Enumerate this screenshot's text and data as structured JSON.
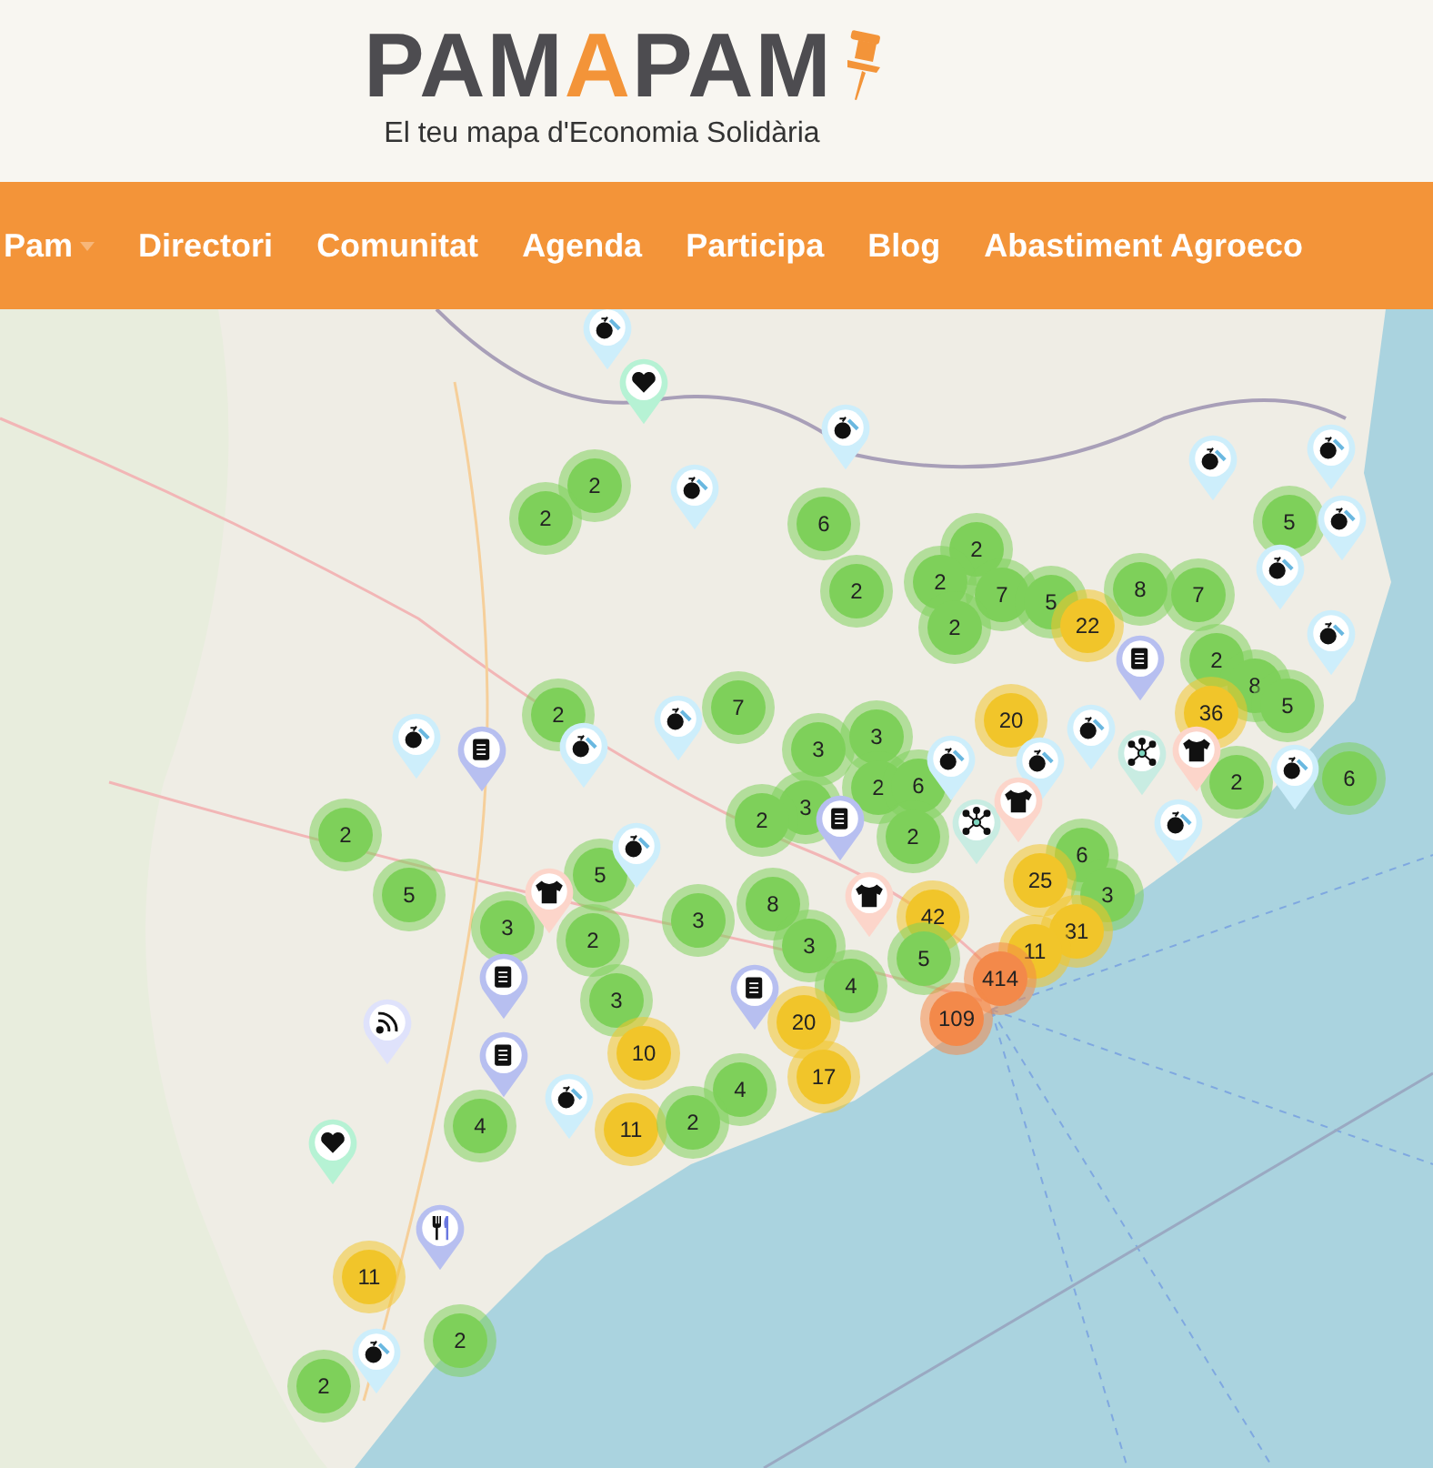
{
  "logo": {
    "parts": [
      "PAM",
      "A",
      "PAM"
    ],
    "tagline": "El teu mapa d'Economia Solidària"
  },
  "nav": [
    {
      "label": "Pam",
      "dropdown": true
    },
    {
      "label": "Directori",
      "dropdown": false
    },
    {
      "label": "Comunitat",
      "dropdown": false
    },
    {
      "label": "Agenda",
      "dropdown": false
    },
    {
      "label": "Participa",
      "dropdown": false
    },
    {
      "label": "Blog",
      "dropdown": false
    },
    {
      "label": "Abastiment Agroeco",
      "dropdown": false
    }
  ],
  "map": {
    "clusters": [
      {
        "count": "2",
        "color": "#7ed05a"
      },
      {
        "count": "2",
        "color": "#7ed05a"
      },
      {
        "count": "6",
        "color": "#7ed05a"
      },
      {
        "count": "2",
        "color": "#7ed05a"
      },
      {
        "count": "2",
        "color": "#7ed05a"
      },
      {
        "count": "2",
        "color": "#7ed05a"
      },
      {
        "count": "7",
        "color": "#7ed05a"
      },
      {
        "count": "2",
        "color": "#7ed05a"
      },
      {
        "count": "5",
        "color": "#7ed05a"
      },
      {
        "count": "22",
        "color": "#f1c52a"
      },
      {
        "count": "8",
        "color": "#7ed05a"
      },
      {
        "count": "7",
        "color": "#7ed05a"
      },
      {
        "count": "5",
        "color": "#7ed05a"
      },
      {
        "count": "2",
        "color": "#7ed05a"
      },
      {
        "count": "8",
        "color": "#7ed05a"
      },
      {
        "count": "36",
        "color": "#f1c52a"
      },
      {
        "count": "5",
        "color": "#7ed05a"
      },
      {
        "count": "2",
        "color": "#7ed05a"
      },
      {
        "count": "6",
        "color": "#7ed05a"
      },
      {
        "count": "2",
        "color": "#7ed05a"
      },
      {
        "count": "7",
        "color": "#7ed05a"
      },
      {
        "count": "20",
        "color": "#f1c52a"
      },
      {
        "count": "3",
        "color": "#7ed05a"
      },
      {
        "count": "3",
        "color": "#7ed05a"
      },
      {
        "count": "2",
        "color": "#7ed05a"
      },
      {
        "count": "6",
        "color": "#7ed05a"
      },
      {
        "count": "3",
        "color": "#7ed05a"
      },
      {
        "count": "2",
        "color": "#7ed05a"
      },
      {
        "count": "2",
        "color": "#7ed05a"
      },
      {
        "count": "2",
        "color": "#7ed05a"
      },
      {
        "count": "5",
        "color": "#7ed05a"
      },
      {
        "count": "5",
        "color": "#7ed05a"
      },
      {
        "count": "3",
        "color": "#7ed05a"
      },
      {
        "count": "2",
        "color": "#7ed05a"
      },
      {
        "count": "3",
        "color": "#7ed05a"
      },
      {
        "count": "8",
        "color": "#7ed05a"
      },
      {
        "count": "3",
        "color": "#7ed05a"
      },
      {
        "count": "6",
        "color": "#7ed05a"
      },
      {
        "count": "25",
        "color": "#f1c52a"
      },
      {
        "count": "3",
        "color": "#7ed05a"
      },
      {
        "count": "42",
        "color": "#f1c52a"
      },
      {
        "count": "31",
        "color": "#f1c52a"
      },
      {
        "count": "5",
        "color": "#7ed05a"
      },
      {
        "count": "11",
        "color": "#f1c52a"
      },
      {
        "count": "4",
        "color": "#7ed05a"
      },
      {
        "count": "3",
        "color": "#7ed05a"
      },
      {
        "count": "20",
        "color": "#f1c52a"
      },
      {
        "count": "414",
        "color": "#f3894a"
      },
      {
        "count": "109",
        "color": "#f3894a"
      },
      {
        "count": "10",
        "color": "#f1c52a"
      },
      {
        "count": "17",
        "color": "#f1c52a"
      },
      {
        "count": "4",
        "color": "#7ed05a"
      },
      {
        "count": "4",
        "color": "#7ed05a"
      },
      {
        "count": "11",
        "color": "#f1c52a"
      },
      {
        "count": "2",
        "color": "#7ed05a"
      },
      {
        "count": "11",
        "color": "#f1c52a"
      },
      {
        "count": "2",
        "color": "#7ed05a"
      },
      {
        "count": "2",
        "color": "#7ed05a"
      }
    ],
    "pins": [
      {
        "kind": "fruit",
        "color": "#cdeefb"
      },
      {
        "kind": "heart",
        "color": "#b6f2d4"
      },
      {
        "kind": "fruit",
        "color": "#cdeefb"
      },
      {
        "kind": "fruit",
        "color": "#cdeefb"
      },
      {
        "kind": "fruit",
        "color": "#cdeefb"
      },
      {
        "kind": "fruit",
        "color": "#cdeefb"
      },
      {
        "kind": "fruit",
        "color": "#cdeefb"
      },
      {
        "kind": "fruit",
        "color": "#cdeefb"
      },
      {
        "kind": "fruit",
        "color": "#cdeefb"
      },
      {
        "kind": "document",
        "color": "#b7bff0"
      },
      {
        "kind": "fruit",
        "color": "#cdeefb"
      },
      {
        "kind": "document",
        "color": "#b7bff0"
      },
      {
        "kind": "fruit",
        "color": "#cdeefb"
      },
      {
        "kind": "fruit",
        "color": "#cdeefb"
      },
      {
        "kind": "fruit",
        "color": "#cdeefb"
      },
      {
        "kind": "fruit",
        "color": "#cdeefb"
      },
      {
        "kind": "fruit",
        "color": "#cdeefb"
      },
      {
        "kind": "network",
        "color": "#c8ece2"
      },
      {
        "kind": "shirt",
        "color": "#fcd5ca"
      },
      {
        "kind": "fruit",
        "color": "#cdeefb"
      },
      {
        "kind": "fruit",
        "color": "#cdeefb"
      },
      {
        "kind": "network",
        "color": "#c8ece2"
      },
      {
        "kind": "shirt",
        "color": "#fcd5ca"
      },
      {
        "kind": "document",
        "color": "#b7bff0"
      },
      {
        "kind": "shirt",
        "color": "#fcd5ca"
      },
      {
        "kind": "fruit",
        "color": "#cdeefb"
      },
      {
        "kind": "shirt",
        "color": "#fcd5ca"
      },
      {
        "kind": "document",
        "color": "#b7bff0"
      },
      {
        "kind": "document",
        "color": "#b7bff0"
      },
      {
        "kind": "signal",
        "color": "#dfe2fb"
      },
      {
        "kind": "document",
        "color": "#b7bff0"
      },
      {
        "kind": "fruit",
        "color": "#cdeefb"
      },
      {
        "kind": "heart",
        "color": "#b6f2d4"
      },
      {
        "kind": "cutlery",
        "color": "#b7bff0"
      },
      {
        "kind": "fruit",
        "color": "#cdeefb"
      }
    ]
  }
}
